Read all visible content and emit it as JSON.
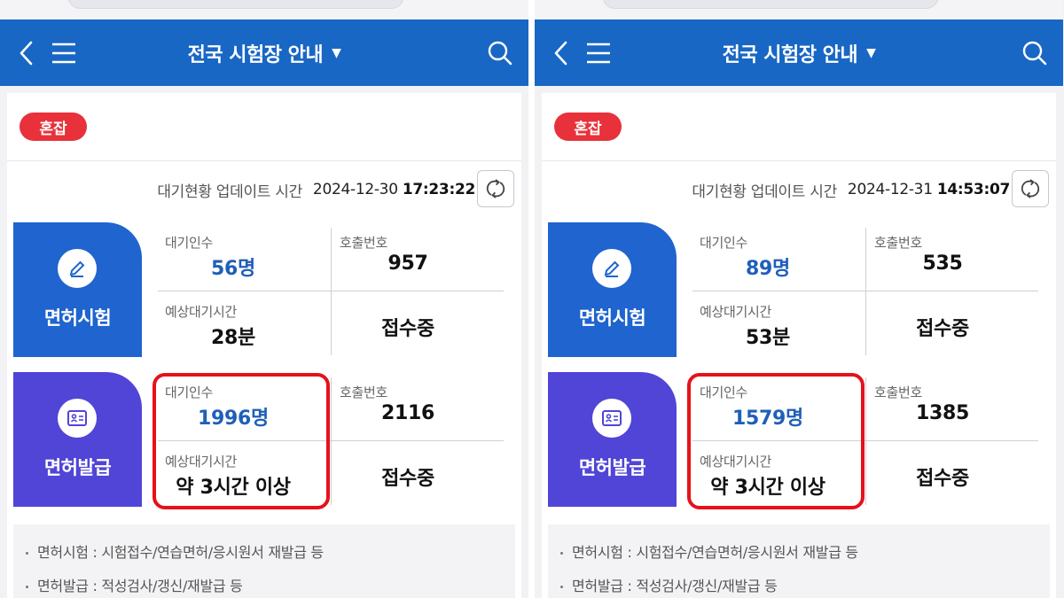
{
  "app": {
    "title": "전국 시험장 안내",
    "caret": "▼"
  },
  "colors": {
    "appbar": "#1967c4",
    "badge": "#e8313a",
    "exam_tile": "#1f64cf",
    "issue_tile": "#5045d6",
    "highlight": "#e6111a",
    "wait_value": "#1f5fb8"
  },
  "icons": {
    "back": "chevron-left-icon",
    "menu": "hamburger-menu-icon",
    "search": "search-icon",
    "refresh": "refresh-icon",
    "exam": "pencil-icon",
    "issue": "id-card-icon"
  },
  "labels": {
    "update": "대기현황 업데이트 시간",
    "waiting_count": "대기인수",
    "call_number": "호출번호",
    "expected_wait": "예상대기시간",
    "exam_service": "면허시험",
    "issue_service": "면허발급"
  },
  "notes": [
    "면허시험 : 시험접수/연습면허/응시원서 재발급 등",
    "면허발급 : 적성검사/갱신/재발급 등"
  ],
  "panels": [
    {
      "badge": "혼잡",
      "update_date": "2024-12-30",
      "update_time": "17:23:22",
      "exam": {
        "waiting_count": "56명",
        "call_number": "957",
        "expected_wait": "28분",
        "status": "접수중"
      },
      "issue": {
        "waiting_count": "1996명",
        "call_number": "2116",
        "expected_wait": "약 3시간 이상",
        "status": "접수중"
      }
    },
    {
      "badge": "혼잡",
      "update_date": "2024-12-31",
      "update_time": "14:53:07",
      "exam": {
        "waiting_count": "89명",
        "call_number": "535",
        "expected_wait": "53분",
        "status": "접수중"
      },
      "issue": {
        "waiting_count": "1579명",
        "call_number": "1385",
        "expected_wait": "약 3시간 이상",
        "status": "접수중"
      }
    }
  ]
}
